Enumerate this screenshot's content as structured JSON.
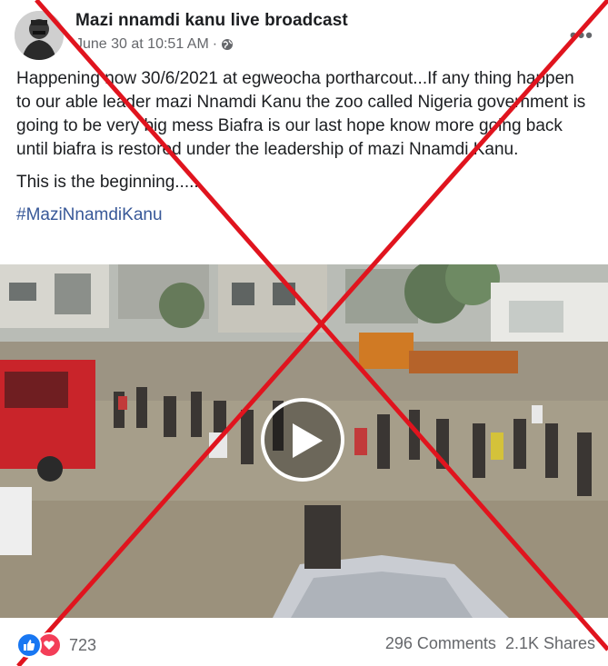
{
  "post": {
    "author": "Mazi nnamdi kanu live broadcast",
    "timestamp": "June 30 at 10:51 AM",
    "separator": "·",
    "privacy_icon": "globe-icon",
    "more_icon": "•••",
    "body_paragraphs": [
      "Happening now 30/6/2021 at egweocha portharcout...If any thing happen to our able leader mazi Nnamdi Kanu the zoo called   Nigeria government is going to be very big mess Biafra is our last hope know more going back until biafra is restored under the leadership of mazi Nnamdi Kanu.",
      "This is the beginning....."
    ],
    "hashtag": "#MaziNnamdiKanu",
    "video": {
      "play_icon": "play-icon"
    },
    "footer": {
      "reaction_count": "723",
      "comments": "296 Comments",
      "shares": "2.1K Shares"
    }
  },
  "colors": {
    "text": "#1c1e21",
    "secondary": "#65676b",
    "hashtag": "#385898",
    "like": "#1877f2",
    "love": "#f33e58",
    "overlay_x": "#e0141e"
  }
}
